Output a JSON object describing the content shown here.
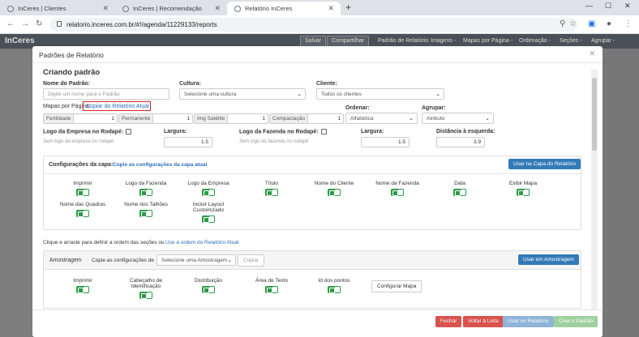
{
  "browser": {
    "tabs": [
      {
        "label": "InCeres | Clientes"
      },
      {
        "label": "InCeres | Recomendação"
      },
      {
        "label": "Relatório InCeres"
      }
    ],
    "url": "relatorio.inceres.com.br/#!/agenda/11229133/reports"
  },
  "appbar": {
    "logo": "InCeres",
    "save": "Salvar",
    "share": "Compartilhar",
    "menu": [
      "Padrão de Relatório",
      "Imagens -",
      "Mapas por Página -",
      "Ordenação -",
      "Seções -",
      "Agrupar -"
    ]
  },
  "modal": {
    "title": "Padrões de Relatório",
    "heading": "Criando padrão",
    "name_label": "Nome do Padrão:",
    "name_placeholder": "Digite um nome para o Padrão",
    "culture_label": "Cultura:",
    "culture_value": "Selecione uma cultura",
    "client_label": "Cliente:",
    "client_value": "Todos os clientes",
    "maps_label": "Mapas por Página:",
    "maps_link": "Copiar do Relatório Atual",
    "maps": [
      {
        "label": "Fertilidade",
        "value": "1"
      },
      {
        "label": "Permanente",
        "value": "1"
      },
      {
        "label": "Img Satélite",
        "value": "1"
      },
      {
        "label": "Compactação",
        "value": "1"
      }
    ],
    "order_label": "Ordenar:",
    "order_value": "Alfabética",
    "group_label": "Agrupar:",
    "group_value": "Atributo",
    "logo_company_label": "Logo da Empresa no Rodapé:",
    "logo_company_note": "Sem logo da empresa no rodapé",
    "width_label": "Largura:",
    "width1": "1.5",
    "logo_farm_label": "Logo da Fazenda no Rodapé:",
    "logo_farm_note": "Sem logo da fazenda no rodapé",
    "width2": "1.5",
    "left_dist_label": "Distância à esquerda:",
    "left_dist": "3.9",
    "cover": {
      "title": "Configurações da capa:",
      "copy_link": "Copie as configurações da capa atual",
      "use_btn": "Usar na Capa do Relatório",
      "options": [
        "Imprimir",
        "Logo da Fazenda",
        "Logo da Empresa",
        "Título",
        "Nome do Cliente",
        "Nome da Fazenda",
        "Data",
        "Exibir Mapa"
      ],
      "options2": [
        "Nome das Quadras",
        "Nome dos Talhões",
        "Incluir Layout Customizado"
      ]
    },
    "sections_text": "Clique e arraste para definir a ordem das seções ou",
    "sections_link": "Use a ordem do Relatório Atual",
    "sampling": {
      "title": "Amostragem",
      "copy_label": "Copie as configurações de",
      "select": "Selecione uma Amostragem",
      "copy_btn": "Copiar",
      "use_btn": "Usar em Amostragem",
      "options": [
        "Imprimir",
        "Cabeçalho de Identificação",
        "Distribuição",
        "Área de Texto",
        "Id dos pontos"
      ],
      "config_btn": "Configurar Mapa"
    },
    "footer": {
      "close": "Fechar",
      "back": "Voltar à Lista",
      "use": "Usar no Relatório",
      "create": "Criar o Padrão"
    }
  }
}
